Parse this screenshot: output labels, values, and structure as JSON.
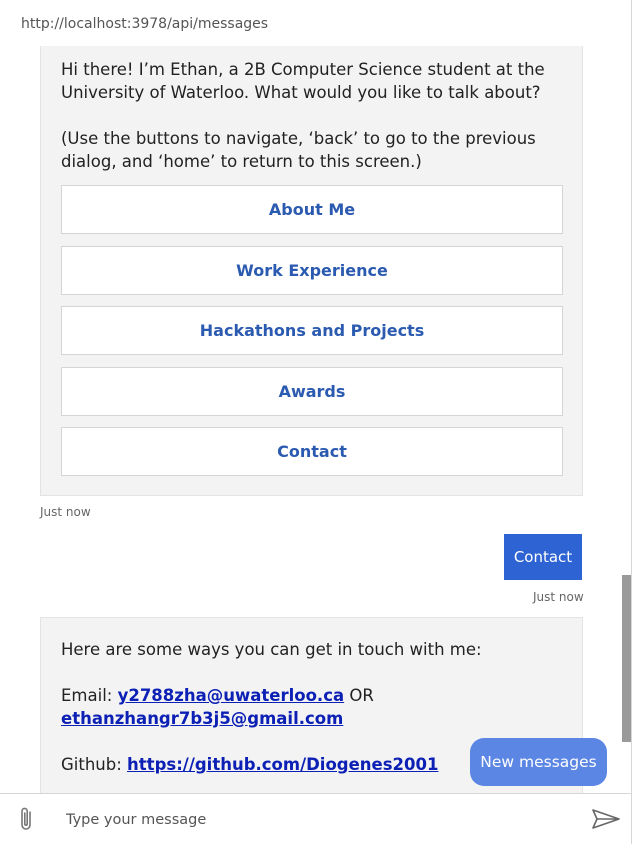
{
  "window": {
    "url": "http://localhost:3978/api/messages"
  },
  "messages": {
    "intro": {
      "line1": "Hi there! I’m Ethan, a 2B Computer Science student at the University of Waterloo. What would you like to talk about?",
      "line2": "(Use the buttons to navigate, ‘back’ to go to the previous dialog, and ‘home’ to return to this screen.)",
      "buttons": [
        "About Me",
        "Work Experience",
        "Hackathons and Projects",
        "Awards",
        "Contact"
      ],
      "timestamp": "Just now"
    },
    "user": {
      "text": "Contact",
      "timestamp": "Just now"
    },
    "contact": {
      "intro": "Here are some ways you can get in touch with me:",
      "email_label": "Email: ",
      "email1": "y2788zha@uwaterloo.ca",
      "or": " OR",
      "email2": "ethanzhangr7b3j5@gmail.com",
      "github_label": "Github: ",
      "github_url": "https://github.com/Diogenes2001"
    }
  },
  "new_messages_label": "New messages",
  "composer": {
    "placeholder": "Type your message"
  },
  "colors": {
    "accent": "#2d63d3",
    "link": "#0c20b5",
    "button_text": "#2b5ab1",
    "new_messages_bg": "#5b86e4"
  }
}
